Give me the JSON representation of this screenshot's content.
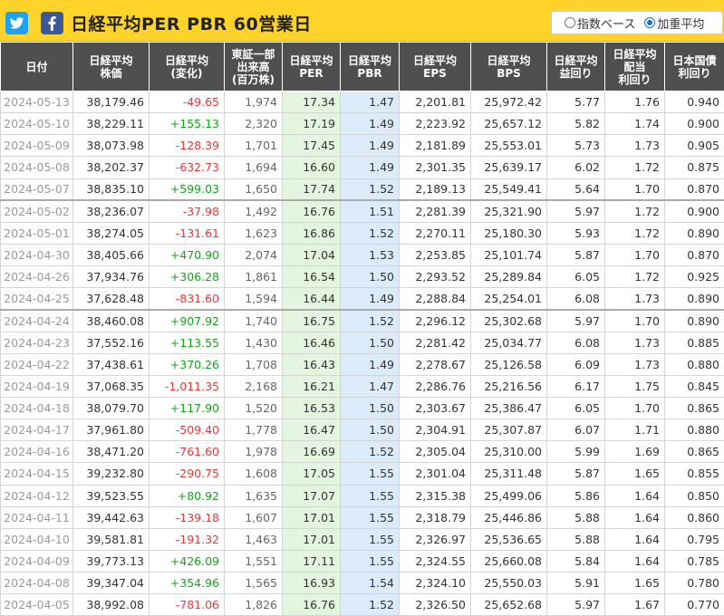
{
  "header": {
    "title": "日経平均PER PBR 60営業日",
    "radio_options": [
      {
        "label": "指数ベース",
        "selected": false
      },
      {
        "label": "加重平均",
        "selected": true
      }
    ]
  },
  "colors": {
    "header_bg": "#ffd32a",
    "table_header_bg": "#4f4f4f",
    "positive": "#16a31b",
    "negative": "#e63b3b",
    "per_bg": "#e3f4df",
    "pbr_bg": "#dcebfa",
    "twitter": "#1da1f2",
    "facebook": "#3b5998"
  },
  "icons": [
    "twitter-icon",
    "facebook-icon"
  ],
  "columns": [
    "日付",
    "日経平均\n株価",
    "日経平均\n(変化)",
    "東証一部\n出来高\n(百万株)",
    "日経平均\nPER",
    "日経平均\nPBR",
    "日経平均\nEPS",
    "日経平均\nBPS",
    "日経平均\n益回り",
    "日経平均\n配当\n利回り",
    "日本国債\n利回り"
  ],
  "rows": [
    [
      "2024-05-13",
      "38,179.46",
      "-49.65",
      "1,974",
      "17.34",
      "1.47",
      "2,201.81",
      "25,972.42",
      "5.77",
      "1.76",
      "0.940"
    ],
    [
      "2024-05-10",
      "38,229.11",
      "+155.13",
      "2,320",
      "17.19",
      "1.49",
      "2,223.92",
      "25,657.12",
      "5.82",
      "1.74",
      "0.900"
    ],
    [
      "2024-05-09",
      "38,073.98",
      "-128.39",
      "1,701",
      "17.45",
      "1.49",
      "2,181.89",
      "25,553.01",
      "5.73",
      "1.73",
      "0.905"
    ],
    [
      "2024-05-08",
      "38,202.37",
      "-632.73",
      "1,694",
      "16.60",
      "1.49",
      "2,301.35",
      "25,639.17",
      "6.02",
      "1.72",
      "0.875"
    ],
    [
      "2024-05-07",
      "38,835.10",
      "+599.03",
      "1,650",
      "17.74",
      "1.52",
      "2,189.13",
      "25,549.41",
      "5.64",
      "1.70",
      "0.870"
    ],
    [
      "2024-05-02",
      "38,236.07",
      "-37.98",
      "1,492",
      "16.76",
      "1.51",
      "2,281.39",
      "25,321.90",
      "5.97",
      "1.72",
      "0.900"
    ],
    [
      "2024-05-01",
      "38,274.05",
      "-131.61",
      "1,623",
      "16.86",
      "1.52",
      "2,270.11",
      "25,180.30",
      "5.93",
      "1.72",
      "0.890"
    ],
    [
      "2024-04-30",
      "38,405.66",
      "+470.90",
      "2,074",
      "17.04",
      "1.53",
      "2,253.85",
      "25,101.74",
      "5.87",
      "1.70",
      "0.870"
    ],
    [
      "2024-04-26",
      "37,934.76",
      "+306.28",
      "1,861",
      "16.54",
      "1.50",
      "2,293.52",
      "25,289.84",
      "6.05",
      "1.72",
      "0.925"
    ],
    [
      "2024-04-25",
      "37,628.48",
      "-831.60",
      "1,594",
      "16.44",
      "1.49",
      "2,288.84",
      "25,254.01",
      "6.08",
      "1.73",
      "0.890"
    ],
    [
      "2024-04-24",
      "38,460.08",
      "+907.92",
      "1,740",
      "16.75",
      "1.52",
      "2,296.12",
      "25,302.68",
      "5.97",
      "1.70",
      "0.890"
    ],
    [
      "2024-04-23",
      "37,552.16",
      "+113.55",
      "1,430",
      "16.46",
      "1.50",
      "2,281.42",
      "25,034.77",
      "6.08",
      "1.73",
      "0.885"
    ],
    [
      "2024-04-22",
      "37,438.61",
      "+370.26",
      "1,708",
      "16.43",
      "1.49",
      "2,278.67",
      "25,126.58",
      "6.09",
      "1.73",
      "0.880"
    ],
    [
      "2024-04-19",
      "37,068.35",
      "-1,011.35",
      "2,168",
      "16.21",
      "1.47",
      "2,286.76",
      "25,216.56",
      "6.17",
      "1.75",
      "0.845"
    ],
    [
      "2024-04-18",
      "38,079.70",
      "+117.90",
      "1,520",
      "16.53",
      "1.50",
      "2,303.67",
      "25,386.47",
      "6.05",
      "1.70",
      "0.865"
    ],
    [
      "2024-04-17",
      "37,961.80",
      "-509.40",
      "1,778",
      "16.47",
      "1.50",
      "2,304.91",
      "25,307.87",
      "6.07",
      "1.71",
      "0.880"
    ],
    [
      "2024-04-16",
      "38,471.20",
      "-761.60",
      "1,978",
      "16.69",
      "1.52",
      "2,305.04",
      "25,310.00",
      "5.99",
      "1.69",
      "0.865"
    ],
    [
      "2024-04-15",
      "39,232.80",
      "-290.75",
      "1,608",
      "17.05",
      "1.55",
      "2,301.04",
      "25,311.48",
      "5.87",
      "1.65",
      "0.855"
    ],
    [
      "2024-04-12",
      "39,523.55",
      "+80.92",
      "1,635",
      "17.07",
      "1.55",
      "2,315.38",
      "25,499.06",
      "5.86",
      "1.64",
      "0.850"
    ],
    [
      "2024-04-11",
      "39,442.63",
      "-139.18",
      "1,607",
      "17.01",
      "1.55",
      "2,318.79",
      "25,446.86",
      "5.88",
      "1.64",
      "0.860"
    ],
    [
      "2024-04-10",
      "39,581.81",
      "-191.32",
      "1,463",
      "17.01",
      "1.55",
      "2,326.97",
      "25,536.65",
      "5.88",
      "1.64",
      "0.795"
    ],
    [
      "2024-04-09",
      "39,773.13",
      "+426.09",
      "1,551",
      "17.11",
      "1.55",
      "2,324.55",
      "25,660.08",
      "5.84",
      "1.64",
      "0.785"
    ],
    [
      "2024-04-08",
      "39,347.04",
      "+354.96",
      "1,565",
      "16.93",
      "1.54",
      "2,324.10",
      "25,550.03",
      "5.91",
      "1.65",
      "0.780"
    ],
    [
      "2024-04-05",
      "38,992.08",
      "-781.06",
      "1,826",
      "16.76",
      "1.52",
      "2,326.50",
      "25,652.68",
      "5.97",
      "1.67",
      "0.770"
    ]
  ]
}
